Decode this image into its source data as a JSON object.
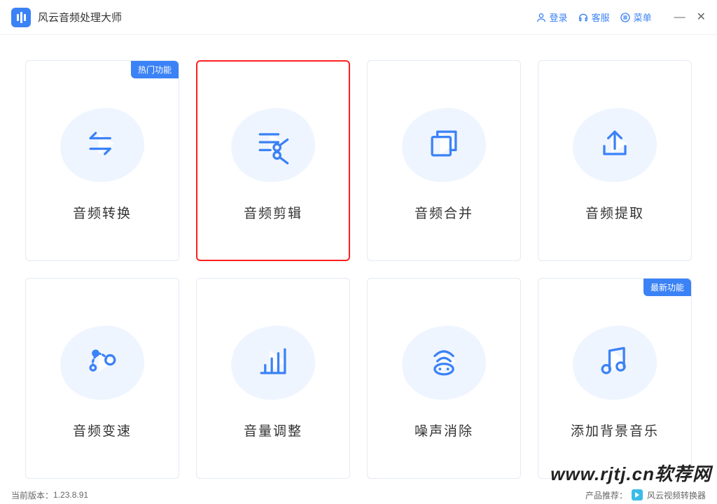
{
  "app": {
    "title": "风云音频处理大师"
  },
  "titlebar": {
    "login": "登录",
    "service": "客服",
    "menu": "菜单"
  },
  "badges": {
    "hot": "热门功能",
    "new": "最新功能"
  },
  "cards": [
    {
      "label": "音频转换"
    },
    {
      "label": "音频剪辑"
    },
    {
      "label": "音频合并"
    },
    {
      "label": "音频提取"
    },
    {
      "label": "音频变速"
    },
    {
      "label": "音量调整"
    },
    {
      "label": "噪声消除"
    },
    {
      "label": "添加背景音乐"
    }
  ],
  "statusbar": {
    "version_label": "当前版本：",
    "version": "1.23.8.91",
    "product_label": "产品推荐：",
    "product": "风云视频转换器"
  },
  "watermark": "www.rjtj.cn软荐网"
}
